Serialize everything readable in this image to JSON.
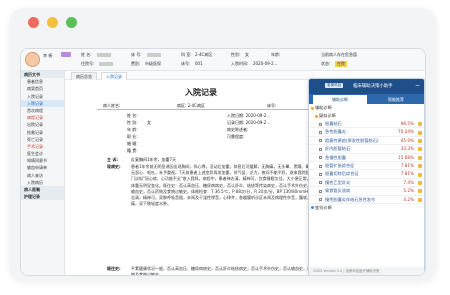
{
  "colors": {
    "red": "#f06a60",
    "yellow": "#f5c13c",
    "green": "#5ac05a",
    "accent": "#1f4f8a"
  },
  "user": {
    "name": "李 杨",
    "code": ""
  },
  "patient": {
    "name_label": "姓 名:",
    "bed_label": "床 号:",
    "dept_label": "科 室:",
    "dept": "2-4C病区",
    "gender_label": "性别:",
    "gender": "女",
    "age_label": "年龄:",
    "age": "",
    "admit_label": "入院时间:",
    "admit": "2020-09-2...",
    "addr_label": "住院号:",
    "addr": "",
    "type_label": "费别:",
    "type": "市级医保",
    "room_label": "床号:",
    "room": "001",
    "status_label": "状态:",
    "status": "在院",
    "extra": "当前病人存在危急值"
  },
  "sidebar": {
    "items": [
      {
        "label": "病历文书",
        "group": true
      },
      {
        "label": "患者信息"
      },
      {
        "label": "病案首页"
      },
      {
        "label": "入院记录",
        "active": true
      },
      {
        "label": "入院记录",
        "active": true
      },
      {
        "label": "首次病程"
      },
      {
        "label": "病程记录",
        "red": true
      },
      {
        "label": "出院记录"
      },
      {
        "label": "抢救记录"
      },
      {
        "label": "死亡记录"
      },
      {
        "label": "手术记录",
        "red": true
      },
      {
        "label": "医生会诊"
      },
      {
        "label": "知情同意书"
      },
      {
        "label": "输血申请单"
      },
      {
        "label": "病人来访"
      },
      {
        "label": "入院病历"
      },
      {
        "label": "病人医嘱",
        "group": true
      },
      {
        "label": "护理记录",
        "group": true
      }
    ]
  },
  "tabs": [
    "病历总览",
    "入院记录"
  ],
  "document": {
    "title": "入院记录",
    "fields": {
      "name": "病人姓名:",
      "dept": "病区: 2-4C病区",
      "bed": "床号:",
      "f1": "姓 名:",
      "f2": "性 别:",
      "f3": "年 龄:",
      "f4": "职 业:",
      "f5": "婚 姻:",
      "f6": "籍 贯:",
      "g1": "入院日期: 2020-09-2...",
      "g2": "记录日期: 2020-09-2...",
      "g3": "病史陈述者:",
      "g4": "可靠程度:",
      "sex": "女"
    },
    "complaint_label": "主 诉:",
    "complaint": "反复胸闷1年余，加重7天",
    "hpi_label": "现病史:",
    "hpi": "患者1年余前无明显诱因出现胸闷，伴心悸，活动后加重，休息后可缓解，无胸痛，无头晕、黑矇、晕厥，无恶心、呕吐，未予重视。7天前患者上述症状再发加重，伴气促、乏力，夜间不能平卧，遂来我院就诊，门诊拟\"冠心病、心功能不全\"收入我科。病程中，患者神志清，精神可，饮食睡眠欠佳，大小便正常，近期体重无明显变化。既往史：否认高血压、糖尿病病史，否认肝炎、结核等传染病史，否认手术外伤史，否认输血史，否认药物及食物过敏史。体格检查：T 36.5℃，P 88次/分，R 20次/分，BP 130/80mmHg，神志清，精神可，双肺呼吸音粗，未闻及干湿性啰音，心律齐，各瓣膜听诊区未闻及病理性杂音，腹软，无压痛，双下肢轻度水肿。",
    "past_label": "既往史:",
    "past": "平素健康状况一般，否认高血压、糖尿病病史，否认肝炎结核病史，否认手术外伤史，否认输血史，否认药物及食物过敏史。"
  },
  "cds": {
    "logo": "惠美科技",
    "title": "临床辅助决策小助手",
    "tabs": [
      "辅助诊断",
      "智能推荐"
    ],
    "section1": "辅助诊断",
    "sub1": "疑似诊断",
    "rows": [
      {
        "label": "胆囊结石",
        "value": "96.5%"
      },
      {
        "label": "急性胆囊炎",
        "value": "70.24%"
      },
      {
        "label": "阻塞性黄疸(原发性胆管结石)",
        "value": "45.9%"
      },
      {
        "label": "肝内胆管结石",
        "value": "33.3%"
      },
      {
        "label": "急慢性胆囊",
        "value": "15.68%"
      },
      {
        "label": "胆管扩张综合征",
        "value": "7.81%"
      },
      {
        "label": "胆囊切除后综合征",
        "value": "7.81%"
      },
      {
        "label": "慢性乙型肝炎",
        "value": "7.4%"
      },
      {
        "label": "胃食管反流病",
        "value": "5.2%"
      },
      {
        "label": "慢性胆囊炎伴结石急性发作",
        "value": "4.2%"
      }
    ],
    "section2": "鉴别诊断",
    "footer": "CDSS Version 5.0 | 惠美科技医疗辅助决策"
  }
}
